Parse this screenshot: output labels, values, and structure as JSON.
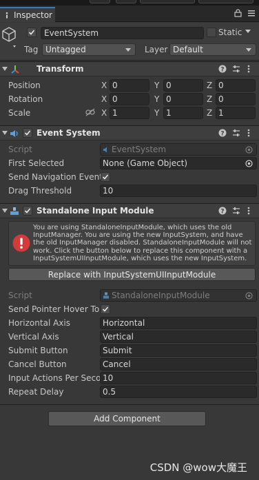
{
  "tab": {
    "label": "Inspector"
  },
  "gameobject": {
    "name": "EventSystem",
    "static_label": "Static",
    "tag_label": "Tag",
    "tag_value": "Untagged",
    "layer_label": "Layer",
    "layer_value": "Default"
  },
  "transform": {
    "title": "Transform",
    "position_label": "Position",
    "rotation_label": "Rotation",
    "scale_label": "Scale",
    "axis_x": "X",
    "axis_y": "Y",
    "axis_z": "Z",
    "position": [
      "0",
      "0",
      "0"
    ],
    "rotation": [
      "0",
      "0",
      "0"
    ],
    "scale": [
      "1",
      "1",
      "1"
    ]
  },
  "event_system": {
    "title": "Event System",
    "script_label": "Script",
    "script_value": "EventSystem",
    "first_selected_label": "First Selected",
    "first_selected_value": "None (Game Object)",
    "send_nav_label": "Send Navigation Events",
    "drag_threshold_label": "Drag Threshold",
    "drag_threshold_value": "10"
  },
  "standalone": {
    "title": "Standalone Input Module",
    "warning": "You are using StandaloneInputModule, which uses the old InputManager. You are using the new InputSystem, and have the old InputManager disabled. StandaloneInputModule will not work. Click the button below to replace this component with a InputSystemUIInputModule, which uses the new InputSystem.",
    "replace_button": "Replace with InputSystemUIInputModule",
    "script_label": "Script",
    "script_value": "StandaloneInputModule",
    "send_pointer_label": "Send Pointer Hover To P",
    "horizontal_label": "Horizontal Axis",
    "horizontal_value": "Horizontal",
    "vertical_label": "Vertical Axis",
    "vertical_value": "Vertical",
    "submit_label": "Submit Button",
    "submit_value": "Submit",
    "cancel_label": "Cancel Button",
    "cancel_value": "Cancel",
    "input_actions_label": "Input Actions Per Secon",
    "input_actions_value": "10",
    "repeat_delay_label": "Repeat Delay",
    "repeat_delay_value": "0.5"
  },
  "add_component": "Add Component",
  "watermark": "CSDN @wow大魔王",
  "colors": {
    "accent": "#3a79bb",
    "warning": "#d33b3b",
    "background": "#383838"
  },
  "icons": [
    "inspector-icon",
    "lock-icon",
    "menu-icon",
    "gameobject-cube-icon",
    "transform-icon",
    "event-system-icon",
    "input-module-icon",
    "help-icon",
    "preset-icon",
    "more-icon",
    "link-scale-icon",
    "object-picker-icon",
    "error-icon",
    "script-icon",
    "checkmark-icon"
  ]
}
